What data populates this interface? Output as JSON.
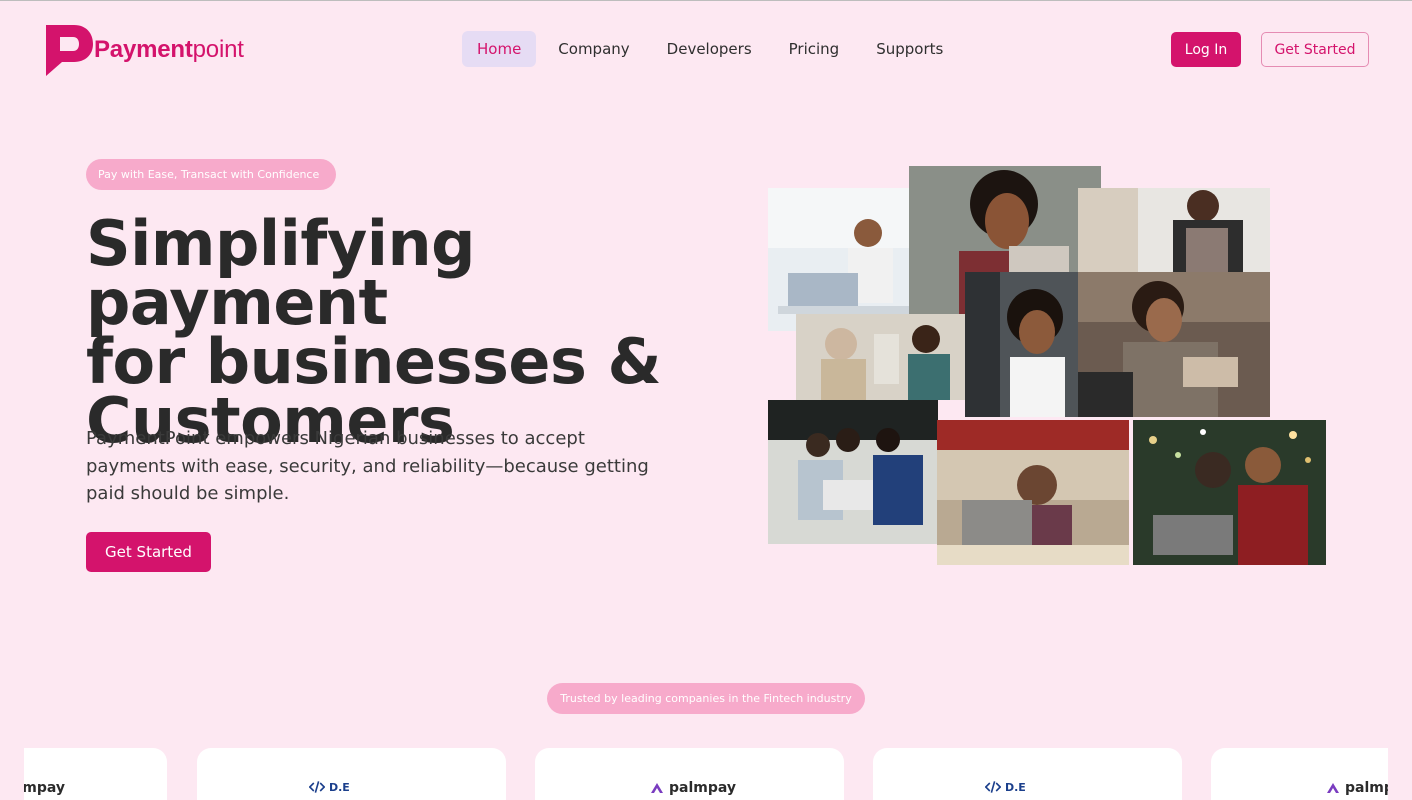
{
  "brand": {
    "name_part1": "Payment",
    "name_part2": "point",
    "color": "#d4136c"
  },
  "nav": {
    "items": [
      {
        "label": "Home",
        "active": true
      },
      {
        "label": "Company",
        "active": false
      },
      {
        "label": "Developers",
        "active": false
      },
      {
        "label": "Pricing",
        "active": false
      },
      {
        "label": "Supports",
        "active": false
      }
    ],
    "login_label": "Log In",
    "get_started_label": "Get Started"
  },
  "hero": {
    "tagline": "Pay with Ease, Transact with Confidence",
    "title_line1": "Simplifying payment",
    "title_line2": "for businesses &",
    "title_line3": "Customers",
    "subtitle": "PaymentPoint empowers Nigerian businesses to accept payments with ease, security, and reliability—because getting paid should be simple.",
    "cta_label": "Get Started"
  },
  "trusted": {
    "label": "Trusted by leading companies in the Fintech industry",
    "logos": [
      {
        "name": "palmpay"
      },
      {
        "name": "D.E"
      },
      {
        "name": "palmpay"
      },
      {
        "name": "D.E"
      },
      {
        "name": "palmpay"
      }
    ]
  },
  "colors": {
    "background": "#fde8f2",
    "accent": "#d4136c",
    "pill": "#f7aacb",
    "active_nav_bg": "#e6dcf4"
  }
}
